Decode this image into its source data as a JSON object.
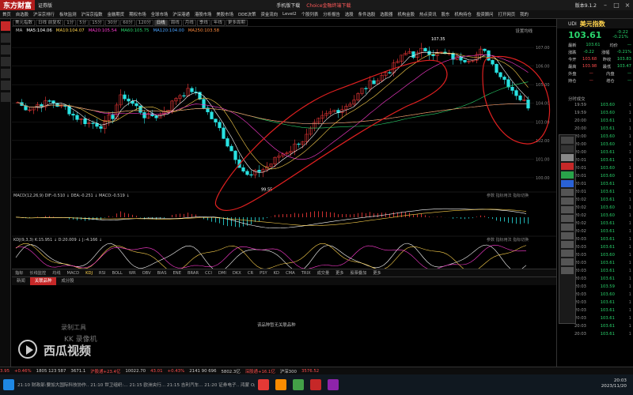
{
  "app": {
    "logo": "东方财富",
    "logo_sub": "证券版",
    "promo1": "手机版下载",
    "promo2": "Choice金融终端下载",
    "version": "版本9.1.2"
  },
  "menu": [
    "首页",
    "自选股",
    "沪深京排行",
    "板块监测",
    "沪深京指数",
    "金融期货",
    "期权市场",
    "全球市场",
    "沪深港通",
    "港股市场",
    "美股市场",
    "DDE决策",
    "资金流向",
    "Level2",
    "个股列表",
    "分析报告",
    "选股",
    "条件选股",
    "选股器",
    "机构金股",
    "热点资讯",
    "股东",
    "机构持仓",
    "投资顾问",
    "打开网页",
    "我的"
  ],
  "chart": {
    "toolbar": [
      "美元指数",
      "日线 前复权",
      "1分",
      "5分",
      "15分",
      "30分",
      "60分",
      "120分",
      "日线",
      "周线",
      "月线",
      "季线",
      "年线",
      "更多周期"
    ],
    "ma_legend": [
      {
        "label": "MA",
        "color": "#cccccc"
      },
      {
        "label": "MA5:104.06",
        "color": "#ffffff"
      },
      {
        "label": "MA10:104.07",
        "color": "#ffd34d"
      },
      {
        "label": "MA20:105.54",
        "color": "#ff3bd1"
      },
      {
        "label": "MA60:105.75",
        "color": "#29d36b"
      },
      {
        "label": "MA120:104.00",
        "color": "#4aa3ff"
      },
      {
        "label": "MA250:103.58",
        "color": "#ff8a3d"
      }
    ],
    "setting": "设置均线",
    "y_ticks": [
      "107.00",
      "106.00",
      "105.00",
      "104.00",
      "103.00",
      "102.00",
      "101.00",
      "100.00"
    ],
    "x_ticks": [
      "05",
      "06",
      "07",
      "08",
      "09",
      "10",
      "11"
    ],
    "high_label": "107.35",
    "low_label": "99.55",
    "macd_legend": "MACD(12,26,9)  DIF:-0.510 ↓  DEA:-0.251 ↓  MACD:-0.519 ↓",
    "kdj_legend": "KDJ(9,3,3)  K:15.951 ↓  D:20.009 ↓  J:-4.166 ↓",
    "panel_tools": "参数  指标用法  指标切换"
  },
  "indicator_tabs": [
    "指标",
    "长线监控",
    "均线",
    "MACD",
    "KDJ",
    "RSI",
    "BOLL",
    "WR",
    "OBV",
    "BIAS",
    "ENE",
    "BRAR",
    "CCI",
    "DMI",
    "DKX",
    "CR",
    "PSY",
    "KD",
    "CMA",
    "TRIX",
    "成交量",
    "更多",
    "股票叠加",
    "更多"
  ],
  "bottom_panel": {
    "tabs": [
      "新闻",
      "关联品种",
      "成分股"
    ],
    "empty_message": "该品种暂无关联品种",
    "watermark1": "录制工具",
    "watermark2": "KK 录像机",
    "watermark3": "西瓜视频"
  },
  "quote": {
    "code": "UDI",
    "name": "美元指数",
    "price": "103.61",
    "change": "-0.22",
    "change_pct": "-0.21%",
    "rows": [
      {
        "k1": "最新",
        "v1": "103.61",
        "k2": "均价",
        "v2": "—"
      },
      {
        "k1": "涨跌",
        "v1": "-0.22",
        "k2": "涨幅",
        "v2": "-0.21%"
      },
      {
        "k1": "今开",
        "v1": "103.68",
        "k2": "昨收",
        "v2": "103.83"
      },
      {
        "k1": "最高",
        "v1": "103.98",
        "k2": "最低",
        "v2": "103.47"
      },
      {
        "k1": "外盘",
        "v1": "—",
        "k2": "内盘",
        "v2": "—"
      },
      {
        "k1": "持仓",
        "v1": "—",
        "k2": "增仓",
        "v2": "—"
      }
    ],
    "ticks_title": "分时成交",
    "ticks": [
      {
        "time": "19:59",
        "price": "103.60",
        "vol": "1"
      },
      {
        "time": "19:59",
        "price": "103.60",
        "vol": "1"
      },
      {
        "time": "20:00",
        "price": "103.61",
        "vol": "1"
      },
      {
        "time": "20:00",
        "price": "103.61",
        "vol": "1"
      },
      {
        "time": "20:00",
        "price": "103.60",
        "vol": "1"
      },
      {
        "time": "20:00",
        "price": "103.60",
        "vol": "1"
      },
      {
        "time": "20:00",
        "price": "103.61",
        "vol": "1"
      },
      {
        "time": "20:01",
        "price": "103.61",
        "vol": "1"
      },
      {
        "time": "20:01",
        "price": "103.60",
        "vol": "1"
      },
      {
        "time": "20:01",
        "price": "103.60",
        "vol": "1"
      },
      {
        "time": "20:01",
        "price": "103.61",
        "vol": "1"
      },
      {
        "time": "20:01",
        "price": "103.61",
        "vol": "1"
      },
      {
        "time": "20:02",
        "price": "103.61",
        "vol": "1"
      },
      {
        "time": "20:02",
        "price": "103.60",
        "vol": "1"
      },
      {
        "time": "20:02",
        "price": "103.60",
        "vol": "1"
      },
      {
        "time": "20:02",
        "price": "103.61",
        "vol": "1"
      },
      {
        "time": "20:02",
        "price": "103.61",
        "vol": "1"
      },
      {
        "time": "20:03",
        "price": "103.61",
        "vol": "1"
      },
      {
        "time": "20:03",
        "price": "103.61",
        "vol": "1"
      },
      {
        "time": "20:03",
        "price": "103.60",
        "vol": "1"
      },
      {
        "time": "20:03",
        "price": "103.61",
        "vol": "1"
      },
      {
        "time": "20:03",
        "price": "103.61",
        "vol": "1"
      },
      {
        "time": "20:03",
        "price": "103.61",
        "vol": "1"
      },
      {
        "time": "20:03",
        "price": "103.59",
        "vol": "1"
      },
      {
        "time": "20:03",
        "price": "103.60",
        "vol": "1"
      },
      {
        "time": "20:03",
        "price": "103.61",
        "vol": "1"
      },
      {
        "time": "20:03",
        "price": "103.61",
        "vol": "1"
      },
      {
        "time": "20:03",
        "price": "103.61",
        "vol": "1"
      },
      {
        "time": "20:03",
        "price": "103.61",
        "vol": "1"
      },
      {
        "time": "20:03",
        "price": "103.61",
        "vol": "1"
      }
    ]
  },
  "statusbar": [
    {
      "text": "3.95",
      "color": "#ff4d4d"
    },
    {
      "text": "+0.46%",
      "color": "#ff4d4d"
    },
    {
      "text": "1805 123 587",
      "color": "#cccccc"
    },
    {
      "text": "3671.1",
      "color": "#cccccc"
    },
    {
      "text": "沪股通+23.4亿",
      "color": "#ff4d4d"
    },
    {
      "text": "10022.70",
      "color": "#cccccc"
    },
    {
      "text": "43.01",
      "color": "#ff4d4d"
    },
    {
      "text": "+0.43%",
      "color": "#ff4d4d"
    },
    {
      "text": "2141 90 696",
      "color": "#cccccc"
    },
    {
      "text": "5802.3亿",
      "color": "#cccccc"
    },
    {
      "text": "深股通+16.1亿",
      "color": "#ff4d4d"
    },
    {
      "text": "沪深300",
      "color": "#cccccc"
    },
    {
      "text": "3576.52",
      "color": "#ff4d4d"
    }
  ],
  "news_ticker": "21:10 财政部:要加大国际科技协作.. 21:10 世卫组织:... 21:15 欧洲央行... 21:15 吉利汽车... 21:20 证券电子.. 鸿蒙 OpenHarmony...",
  "clock": {
    "time": "20:03",
    "date": "2023/11/20"
  }
}
